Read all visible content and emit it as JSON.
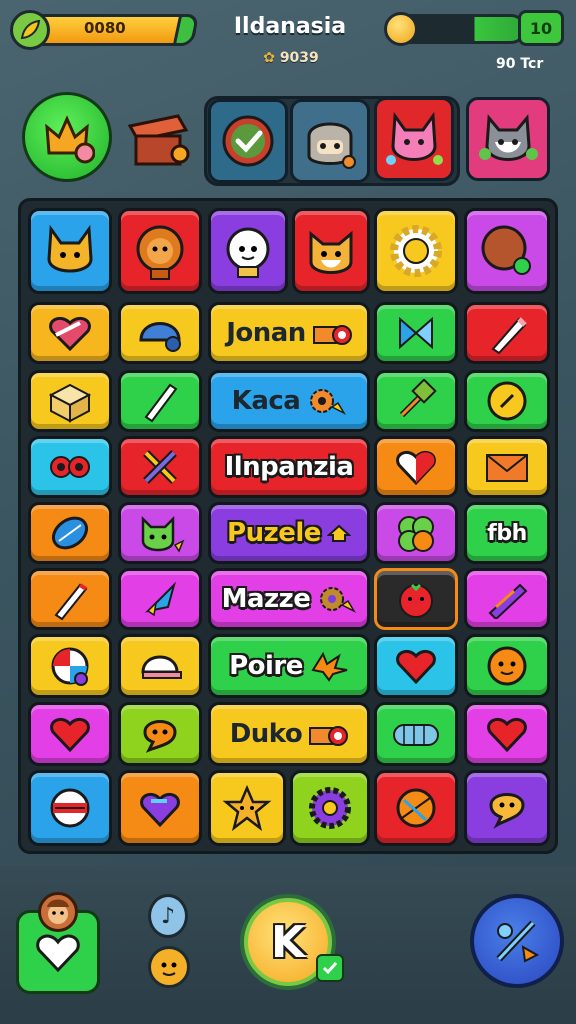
{
  "header": {
    "level_value": "0080",
    "title": "Ildanasia",
    "coins": "9039",
    "score_value": "10",
    "status_label": "90 Tcr"
  },
  "characters": [
    {
      "name": "crown",
      "icon": "crown-icon"
    },
    {
      "name": "chest",
      "icon": "chest-icon"
    },
    {
      "name": "checkmark",
      "icon": "check-orb-icon"
    },
    {
      "name": "hero",
      "icon": "hero-face-icon"
    },
    {
      "name": "pink cat",
      "icon": "pink-cat-icon"
    },
    {
      "name": "grey cat",
      "icon": "grey-cat-icon"
    }
  ],
  "board": {
    "words": [
      {
        "text": "Jonan"
      },
      {
        "text": "Kaca"
      },
      {
        "text": "Ilnpanzia"
      },
      {
        "text": "Puzele"
      },
      {
        "text": "Mazze"
      },
      {
        "text": "Poire"
      },
      {
        "text": "Duko"
      }
    ],
    "side_text": "fbh"
  },
  "colors": {
    "blue": "#2aa3ea",
    "red": "#e8242b",
    "purple": "#8a3ee0",
    "yellow": "#f7c81e",
    "magenta": "#e23fe6",
    "green": "#2fd04a",
    "orange": "#f58a14",
    "lime": "#8fd31e",
    "cyan": "#2bc4e8"
  },
  "bottom": {
    "action_letter": "K"
  }
}
